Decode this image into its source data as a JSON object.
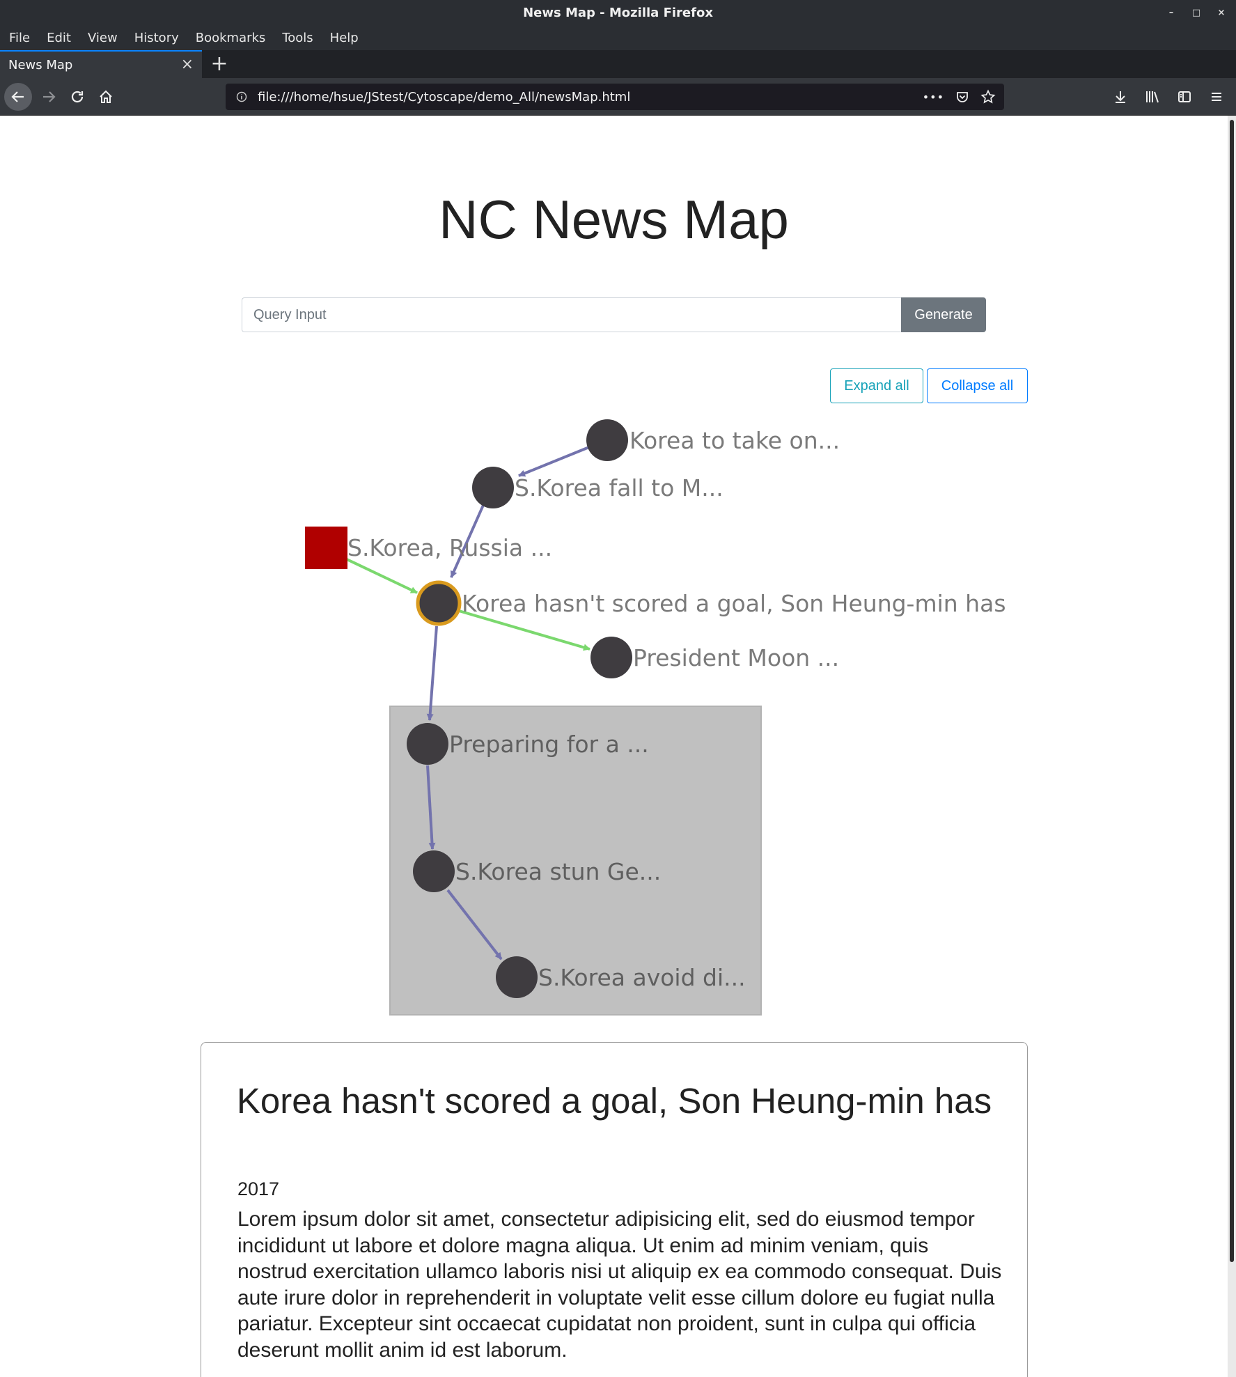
{
  "window": {
    "title": "News Map - Mozilla Firefox",
    "controls": [
      "–",
      "□",
      "×"
    ]
  },
  "menu": [
    "File",
    "Edit",
    "View",
    "History",
    "Bookmarks",
    "Tools",
    "Help"
  ],
  "tab": {
    "label": "News Map",
    "close": "×",
    "new_tab": "+"
  },
  "nav": {
    "url": "file:///home/hsue/JStest/Cytoscape/demo_All/newsMap.html",
    "more": "•••"
  },
  "page": {
    "title": "NC News Map",
    "query_placeholder": "Query Input",
    "generate_label": "Generate",
    "expand_label": "Expand all",
    "collapse_label": "Collapse all"
  },
  "graph": {
    "nodes": [
      {
        "id": "n1",
        "label": "Korea to take on...",
        "shape": "circle"
      },
      {
        "id": "n2",
        "label": "S.Korea fall to M...",
        "shape": "circle"
      },
      {
        "id": "n3",
        "label": "S.Korea, Russia ...",
        "shape": "square"
      },
      {
        "id": "n4",
        "label": "Korea hasn't scored a goal, Son Heung-min has",
        "shape": "circle",
        "selected": true
      },
      {
        "id": "n5",
        "label": "President Moon ...",
        "shape": "circle"
      },
      {
        "id": "n6",
        "label": "Preparing for a ...",
        "shape": "circle",
        "group": "g1"
      },
      {
        "id": "n7",
        "label": "S.Korea stun Ge...",
        "shape": "circle",
        "group": "g1"
      },
      {
        "id": "n8",
        "label": "S.Korea avoid di...",
        "shape": "circle",
        "group": "g1"
      }
    ],
    "edges": [
      {
        "from": "n1",
        "to": "n2",
        "color": "#7373ad"
      },
      {
        "from": "n2",
        "to": "n4",
        "color": "#7373ad"
      },
      {
        "from": "n3",
        "to": "n4",
        "color": "#7bd86e"
      },
      {
        "from": "n4",
        "to": "n5",
        "color": "#7bd86e"
      },
      {
        "from": "n4",
        "to": "n6",
        "color": "#7373ad"
      },
      {
        "from": "n6",
        "to": "n7",
        "color": "#7373ad"
      },
      {
        "from": "n7",
        "to": "n8",
        "color": "#7373ad"
      }
    ],
    "colors": {
      "node": "#3f3c40",
      "square_node": "#b00000",
      "selected_border": "#d99a1e",
      "group_fill": "#c0c0c0"
    }
  },
  "detail": {
    "title": "Korea hasn't scored a goal, Son Heung-min has",
    "year": "2017",
    "body": "Lorem ipsum dolor sit amet, consectetur adipisicing elit, sed do eiusmod tempor incididunt ut labore et dolore magna aliqua. Ut enim ad minim veniam, quis nostrud exercitation ullamco laboris nisi ut aliquip ex ea commodo consequat. Duis aute irure dolor in reprehenderit in voluptate velit esse cillum dolore eu fugiat nulla pariatur. Excepteur sint occaecat cupidatat non proident, sunt in culpa qui officia deserunt mollit anim id est laborum."
  }
}
